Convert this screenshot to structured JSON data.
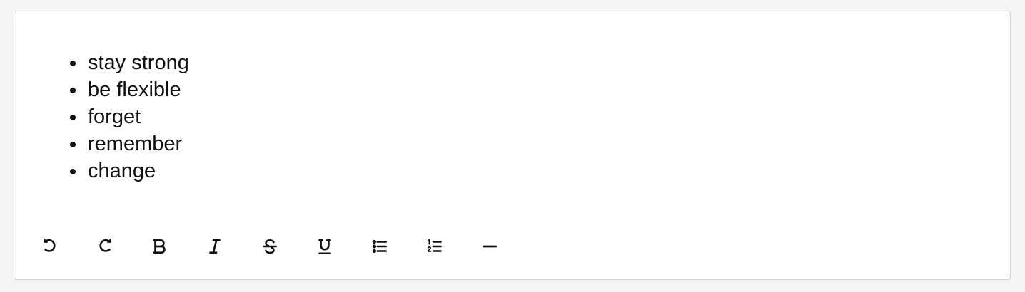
{
  "editor": {
    "list_items": [
      "stay strong",
      "be flexible",
      "forget",
      "remember",
      "change"
    ]
  },
  "toolbar": {
    "buttons": [
      {
        "icon": "undo-icon"
      },
      {
        "icon": "redo-icon"
      },
      {
        "icon": "bold-icon"
      },
      {
        "icon": "italic-icon"
      },
      {
        "icon": "strikethrough-icon"
      },
      {
        "icon": "underline-icon"
      },
      {
        "icon": "bullet-list-icon"
      },
      {
        "icon": "ordered-list-icon"
      },
      {
        "icon": "horizontal-rule-icon"
      }
    ]
  },
  "colors": {
    "text": "#111111",
    "border": "#d4d4d4",
    "background": "#ffffff"
  }
}
